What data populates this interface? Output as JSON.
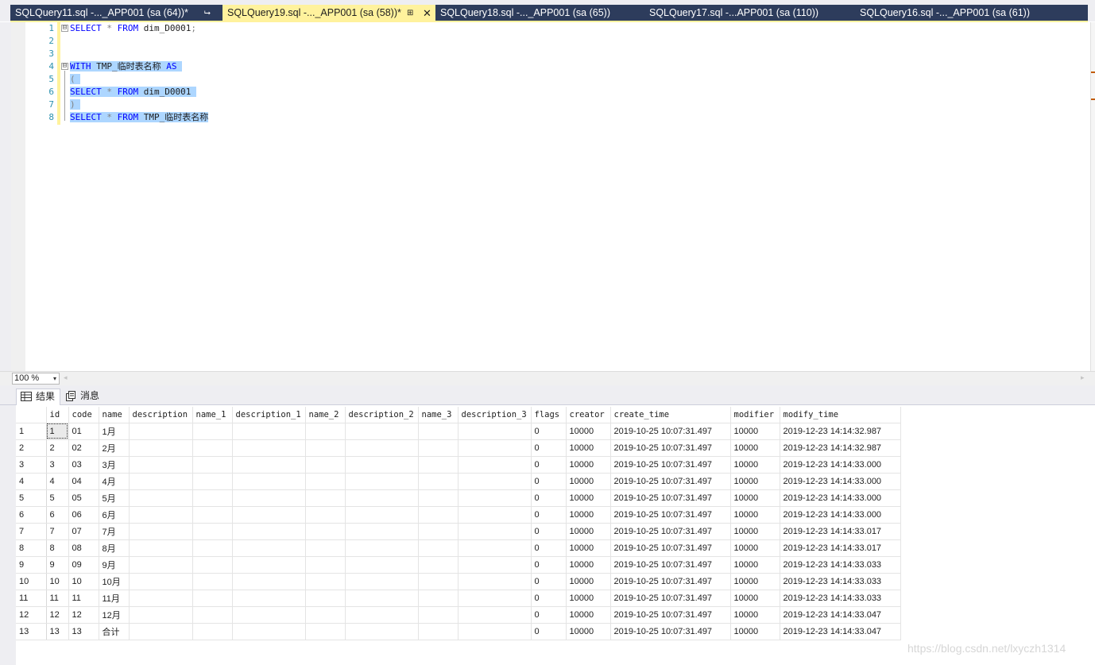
{
  "tabs": [
    {
      "label": "SQLQuery11.sql -..._APP001 (sa (64))*",
      "pin": "⮡",
      "active": false
    },
    {
      "label": "SQLQuery19.sql -..._APP001 (sa (58))*",
      "pin": "⊞",
      "active": true
    },
    {
      "label": "SQLQuery18.sql -..._APP001 (sa (65))",
      "active": false
    },
    {
      "label": "SQLQuery17.sql -...APP001 (sa (110))",
      "active": false
    },
    {
      "label": "SQLQuery16.sql -..._APP001 (sa (61))",
      "active": false
    }
  ],
  "editor": {
    "line_numbers": [
      "1",
      "2",
      "3",
      "4",
      "5",
      "6",
      "7",
      "8"
    ],
    "lines": [
      {
        "tokens": [
          [
            "kw",
            "SELECT"
          ],
          [
            "id",
            " "
          ],
          [
            "op",
            "*"
          ],
          [
            "id",
            " "
          ],
          [
            "kw",
            "FROM"
          ],
          [
            "id",
            " dim_D0001"
          ],
          [
            "op",
            ";"
          ]
        ]
      },
      {
        "tokens": []
      },
      {
        "tokens": []
      },
      {
        "tokens": [
          [
            "kw",
            "WITH"
          ],
          [
            "id",
            " TMP_临时表名称 "
          ],
          [
            "kw",
            "AS"
          ],
          [
            "id",
            " "
          ]
        ],
        "selected": true
      },
      {
        "tokens": [
          [
            "op",
            "("
          ],
          [
            "id",
            " "
          ]
        ],
        "selected": true
      },
      {
        "tokens": [
          [
            "kw",
            "SELECT"
          ],
          [
            "id",
            " "
          ],
          [
            "op",
            "*"
          ],
          [
            "id",
            " "
          ],
          [
            "kw",
            "FROM"
          ],
          [
            "id",
            " dim_D0001 "
          ]
        ],
        "selected": true
      },
      {
        "tokens": [
          [
            "op",
            ")"
          ],
          [
            "id",
            " "
          ]
        ],
        "selected": true
      },
      {
        "tokens": [
          [
            "kw",
            "SELECT"
          ],
          [
            "id",
            " "
          ],
          [
            "op",
            "*"
          ],
          [
            "id",
            " "
          ],
          [
            "kw",
            "FROM"
          ],
          [
            "id",
            " TMP_临时表名称"
          ]
        ],
        "selected": true
      }
    ],
    "fold_markers": [
      "⊟",
      "⊟"
    ]
  },
  "zoom": {
    "value": "100 %",
    "arrow": "▾"
  },
  "scroll": {
    "left": "◂",
    "right": "▸"
  },
  "result_tabs": [
    {
      "label": "结果",
      "active": true
    },
    {
      "label": "消息",
      "active": false
    }
  ],
  "grid": {
    "columns": [
      "id",
      "code",
      "name",
      "description",
      "name_1",
      "description_1",
      "name_2",
      "description_2",
      "name_3",
      "description_3",
      "flags",
      "creator",
      "create_time",
      "modifier",
      "modify_time"
    ],
    "rows": [
      [
        "1",
        "1",
        "01",
        "1月",
        "",
        "",
        "",
        "",
        "",
        "",
        "0",
        "10000",
        "2019-10-25 10:07:31.497",
        "10000",
        "2019-12-23 14:14:32.987"
      ],
      [
        "2",
        "2",
        "02",
        "2月",
        "",
        "",
        "",
        "",
        "",
        "",
        "0",
        "10000",
        "2019-10-25 10:07:31.497",
        "10000",
        "2019-12-23 14:14:32.987"
      ],
      [
        "3",
        "3",
        "03",
        "3月",
        "",
        "",
        "",
        "",
        "",
        "",
        "0",
        "10000",
        "2019-10-25 10:07:31.497",
        "10000",
        "2019-12-23 14:14:33.000"
      ],
      [
        "4",
        "4",
        "04",
        "4月",
        "",
        "",
        "",
        "",
        "",
        "",
        "0",
        "10000",
        "2019-10-25 10:07:31.497",
        "10000",
        "2019-12-23 14:14:33.000"
      ],
      [
        "5",
        "5",
        "05",
        "5月",
        "",
        "",
        "",
        "",
        "",
        "",
        "0",
        "10000",
        "2019-10-25 10:07:31.497",
        "10000",
        "2019-12-23 14:14:33.000"
      ],
      [
        "6",
        "6",
        "06",
        "6月",
        "",
        "",
        "",
        "",
        "",
        "",
        "0",
        "10000",
        "2019-10-25 10:07:31.497",
        "10000",
        "2019-12-23 14:14:33.000"
      ],
      [
        "7",
        "7",
        "07",
        "7月",
        "",
        "",
        "",
        "",
        "",
        "",
        "0",
        "10000",
        "2019-10-25 10:07:31.497",
        "10000",
        "2019-12-23 14:14:33.017"
      ],
      [
        "8",
        "8",
        "08",
        "8月",
        "",
        "",
        "",
        "",
        "",
        "",
        "0",
        "10000",
        "2019-10-25 10:07:31.497",
        "10000",
        "2019-12-23 14:14:33.017"
      ],
      [
        "9",
        "9",
        "09",
        "9月",
        "",
        "",
        "",
        "",
        "",
        "",
        "0",
        "10000",
        "2019-10-25 10:07:31.497",
        "10000",
        "2019-12-23 14:14:33.033"
      ],
      [
        "10",
        "10",
        "10",
        "10月",
        "",
        "",
        "",
        "",
        "",
        "",
        "0",
        "10000",
        "2019-10-25 10:07:31.497",
        "10000",
        "2019-12-23 14:14:33.033"
      ],
      [
        "11",
        "11",
        "11",
        "11月",
        "",
        "",
        "",
        "",
        "",
        "",
        "0",
        "10000",
        "2019-10-25 10:07:31.497",
        "10000",
        "2019-12-23 14:14:33.033"
      ],
      [
        "12",
        "12",
        "12",
        "12月",
        "",
        "",
        "",
        "",
        "",
        "",
        "0",
        "10000",
        "2019-10-25 10:07:31.497",
        "10000",
        "2019-12-23 14:14:33.047"
      ],
      [
        "13",
        "13",
        "13",
        "合计",
        "",
        "",
        "",
        "",
        "",
        "",
        "0",
        "10000",
        "2019-10-25 10:07:31.497",
        "10000",
        "2019-12-23 14:14:33.047"
      ]
    ]
  },
  "watermark": "https://blog.csdn.net/lxyczh1314",
  "colors": {
    "tab_strip": "#2d3c5c",
    "active_tab": "#fff29d",
    "keyword": "#0000ff",
    "operator": "#808080",
    "line_number": "#2b91af",
    "selection": "#add6ff"
  }
}
